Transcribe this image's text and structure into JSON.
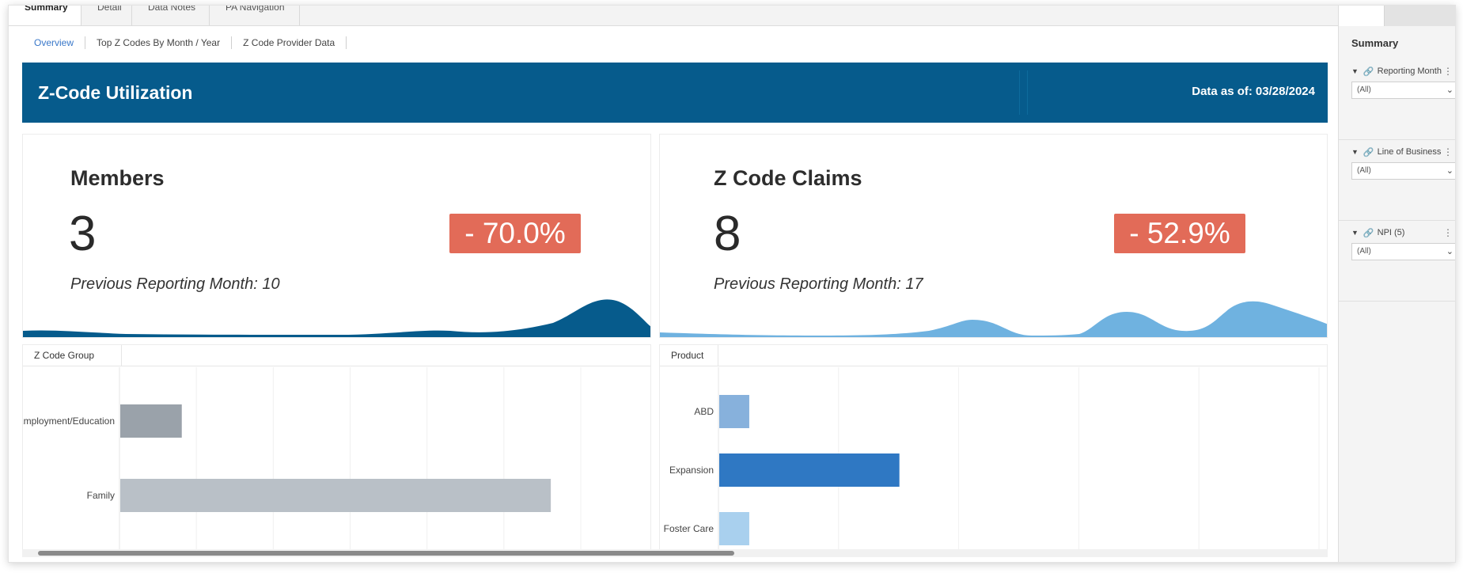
{
  "top_tabs": [
    {
      "label": "Summary",
      "active": true
    },
    {
      "label": "Detail",
      "active": false
    },
    {
      "label": "Data Notes",
      "active": false
    },
    {
      "label": "PA Navigation",
      "active": false
    }
  ],
  "sub_nav": [
    "Overview",
    "Top Z Codes By Month / Year",
    "Z Code Provider Data"
  ],
  "banner": {
    "title": "Z-Code Utilization",
    "date_label": "Data as of:",
    "date_value": "03/28/2024"
  },
  "kpis": [
    {
      "title": "Members",
      "value": "3",
      "change": "- 70.0%",
      "previous": "Previous Reporting Month: 10",
      "sparkline_color": "#065b8c"
    },
    {
      "title": "Z Code Claims",
      "value": "8",
      "change": "- 52.9%",
      "previous": "Previous Reporting Month: 17",
      "sparkline_color": "#6fb2e0"
    }
  ],
  "panels": {
    "left": {
      "header": "Z Code Group"
    },
    "right": {
      "header": "Product"
    }
  },
  "chart_data": [
    {
      "type": "bar",
      "orientation": "horizontal",
      "categories": [
        "Employment/Education",
        "Family"
      ],
      "values": [
        1,
        7
      ],
      "xlim": [
        0,
        7.5
      ],
      "colors": [
        "#9aa2aa",
        "#b9c0c7"
      ]
    },
    {
      "type": "bar",
      "orientation": "horizontal",
      "categories": [
        "ABD",
        "Expansion",
        "Foster Care"
      ],
      "values": [
        0.5,
        3,
        0.5
      ],
      "xlim": [
        0,
        10
      ],
      "colors": [
        "#87b1dc",
        "#2f78c3",
        "#a9d0ee"
      ]
    }
  ],
  "sidebar": {
    "title": "Summary",
    "filters": [
      {
        "label": "Reporting Month...",
        "value": "(All)"
      },
      {
        "label": "Line of Business...",
        "value": "(All)"
      },
      {
        "label": "NPI (5)",
        "value": "(All)"
      }
    ]
  }
}
